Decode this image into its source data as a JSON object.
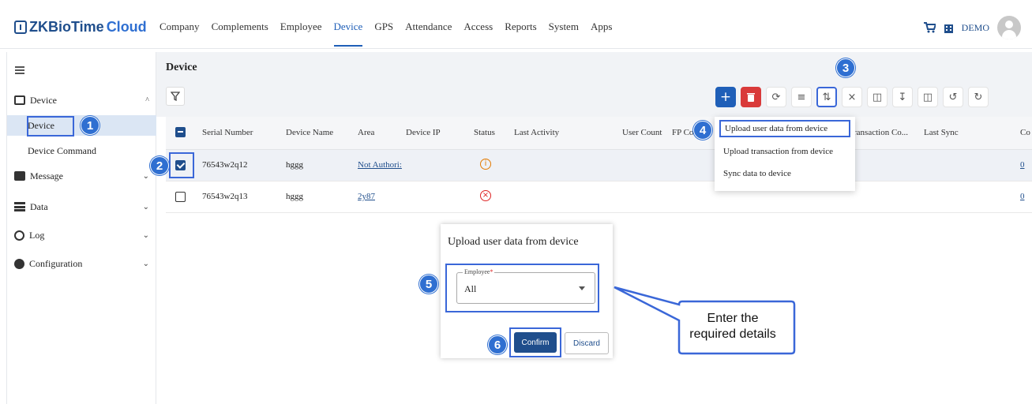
{
  "brand": {
    "name_main": "ZKBioTime",
    "name_accent": "Cloud"
  },
  "nav": [
    "Company",
    "Complements",
    "Employee",
    "Device",
    "GPS",
    "Attendance",
    "Access",
    "Reports",
    "System",
    "Apps"
  ],
  "nav_active": "Device",
  "account": {
    "name": "DEMO"
  },
  "sidebar": {
    "groups": [
      {
        "label": "Device",
        "expanded": true,
        "icon": "device-icon"
      },
      {
        "label": "Message",
        "icon": "message-icon"
      },
      {
        "label": "Data",
        "icon": "data-icon"
      },
      {
        "label": "Log",
        "icon": "log-icon"
      },
      {
        "label": "Configuration",
        "icon": "gear-icon"
      }
    ],
    "device_items": [
      "Device",
      "Device Command"
    ],
    "active_item": "Device"
  },
  "page": {
    "title": "Device"
  },
  "table": {
    "columns": [
      "Serial Number",
      "Device Name",
      "Area",
      "Device IP",
      "Status",
      "Last Activity",
      "User Count",
      "FP Co",
      "ransaction Co...",
      "Last Sync",
      "Co"
    ],
    "rows": [
      {
        "serial": "76543w2q12",
        "name": "hggg",
        "area": "Not Authori:",
        "status": "warning",
        "selected": true,
        "extra": "0"
      },
      {
        "serial": "76543w2q13",
        "name": "hggg",
        "area": "2y87",
        "status": "error",
        "selected": false,
        "extra": "0"
      }
    ]
  },
  "menu": {
    "items": [
      "Upload user data from device",
      "Upload transaction from device",
      "Sync data to device"
    ],
    "highlighted": "Upload user data from device"
  },
  "dialog": {
    "title": "Upload user data from device",
    "field_label": "Employee",
    "field_required": "*",
    "field_value": "All",
    "confirm_label": "Confirm",
    "discard_label": "Discard"
  },
  "callout": {
    "line1": "Enter the",
    "line2": "required details"
  },
  "markers": [
    "1",
    "2",
    "3",
    "4",
    "5",
    "6"
  ],
  "colors": {
    "brand": "#1f4e8c",
    "accent": "#2f6fd1",
    "highlight": "#3a67d8",
    "delete": "#d93a3a",
    "warning": "#e37a00",
    "error": "#dd2222"
  }
}
